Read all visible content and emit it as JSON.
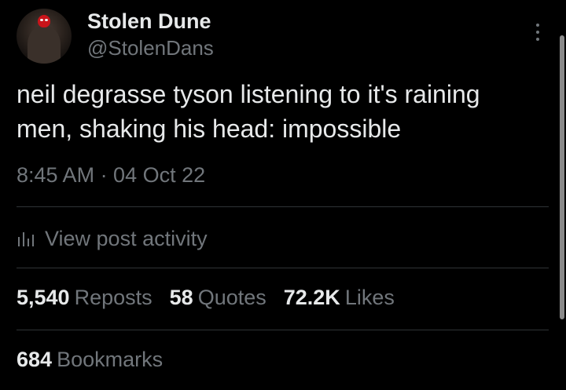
{
  "author": {
    "display_name": "Stolen Dune",
    "handle": "@StolenDans",
    "avatar_icon": "avatar-image"
  },
  "tweet": {
    "text": "neil degrasse tyson listening to it's raining men, shaking his head: impossible",
    "timestamp": "8:45 AM · 04 Oct 22"
  },
  "activity": {
    "label": "View post activity",
    "icon": "bar-chart-icon"
  },
  "stats": {
    "reposts": {
      "count": "5,540",
      "label": "Reposts"
    },
    "quotes": {
      "count": "58",
      "label": "Quotes"
    },
    "likes": {
      "count": "72.2K",
      "label": "Likes"
    },
    "bookmarks": {
      "count": "684",
      "label": "Bookmarks"
    }
  },
  "colors": {
    "background": "#000000",
    "primary_text": "#e7e9ea",
    "secondary_text": "#71767b",
    "divider": "#2f3336"
  }
}
